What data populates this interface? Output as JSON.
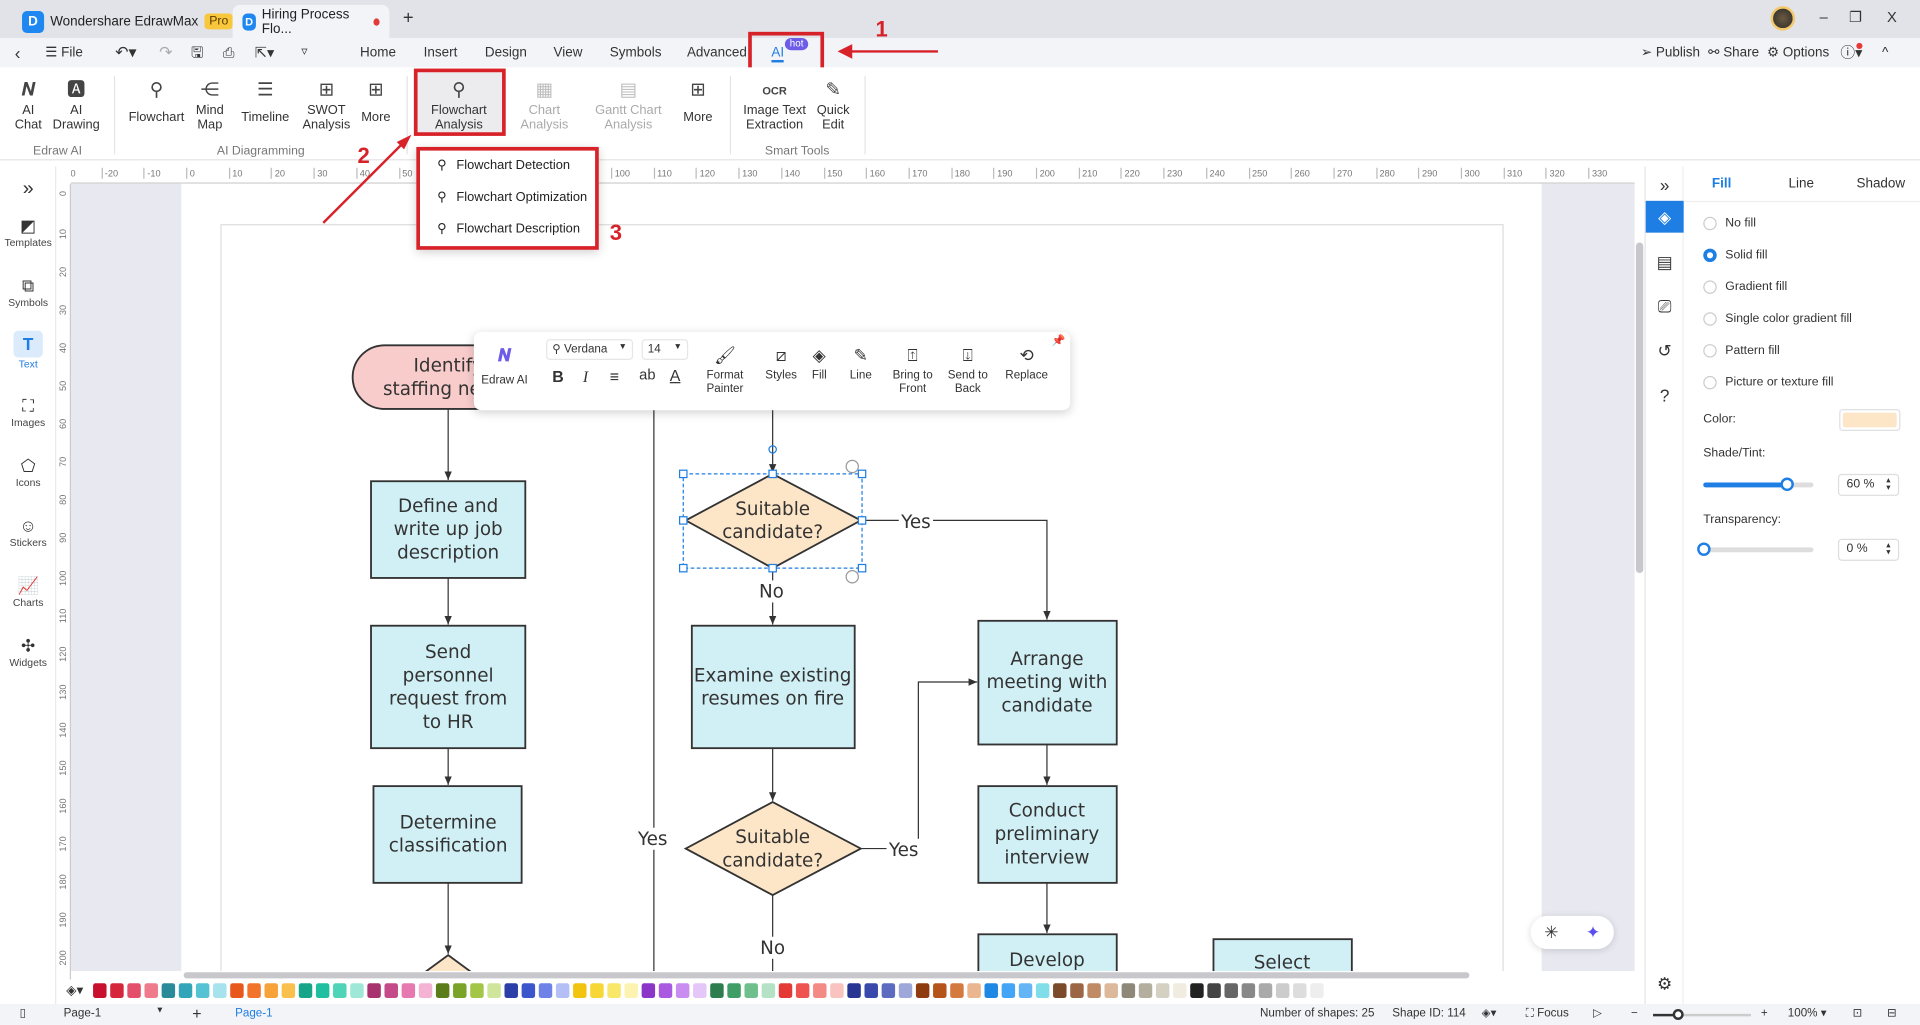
{
  "titlebar": {
    "app_name": "Wondershare EdrawMax",
    "pro_badge": "Pro",
    "doc_tab": "Hiring Process Flo...",
    "new_tab": "+",
    "minimize": "–",
    "restore": "❐",
    "close": "X"
  },
  "menubar": {
    "file": "File",
    "tabs": [
      "Home",
      "Insert",
      "Design",
      "View",
      "Symbols",
      "Advanced",
      "AI"
    ],
    "hot_badge": "hot",
    "publish": "Publish",
    "share": "Share",
    "options": "Options"
  },
  "ribbon": {
    "edraw_ai": {
      "label": "Edraw AI",
      "items": [
        "AI\nChat",
        "AI\nDrawing"
      ]
    },
    "ai_diagramming": {
      "label": "AI Diagramming",
      "items": [
        "Flowchart",
        "Mind\nMap",
        "Timeline",
        "SWOT\nAnalysis",
        "More"
      ]
    },
    "analysis": {
      "items": [
        "Flowchart\nAnalysis",
        "Chart\nAnalysis",
        "Gantt Chart\nAnalysis",
        "More"
      ]
    },
    "smart_tools": {
      "label": "Smart Tools",
      "items": [
        "Image Text\nExtraction",
        "Quick\nEdit"
      ]
    }
  },
  "dropdown": {
    "items": [
      "Flowchart Detection",
      "Flowchart Optimization",
      "Flowchart Description"
    ]
  },
  "annotations": {
    "step1": "1",
    "step2": "2",
    "step3": "3",
    "color": "#d8222a"
  },
  "sidebar": {
    "items": [
      "Templates",
      "Symbols",
      "Text",
      "Images",
      "Icons",
      "Stickers",
      "Charts",
      "Widgets"
    ],
    "active": "Text"
  },
  "rulers": {
    "top": {
      "start": -30,
      "end": 330,
      "step": 10
    },
    "left": {
      "start": 0,
      "end": 200,
      "step": 10
    }
  },
  "float_toolbar": {
    "edraw_ai": "Edraw AI",
    "font": "Verdana",
    "size": "14",
    "format_painter": "Format\nPainter",
    "styles": "Styles",
    "fill": "Fill",
    "line": "Line",
    "bring_front": "Bring to\nFront",
    "send_back": "Send to\nBack",
    "replace": "Replace"
  },
  "flowchart": {
    "terminator": "Identify staffing needs",
    "define": "Define and write up job description",
    "send": "Send personnel request from to HR",
    "determine": "Determine classification",
    "decision1": "Suitable candidate?",
    "examine": "Examine existing resumes on fire",
    "decision2": "Suitable candidate?",
    "arrange": "Arrange meeting with candidate",
    "conduct": "Conduct preliminary interview",
    "develop": "Develop",
    "select": "Select",
    "yes": "Yes",
    "no": "No",
    "box_fill": "#d1f0f5",
    "decision_fill": "#fde6c8",
    "terminator_fill": "#f9cccc"
  },
  "right_panel": {
    "tabs": [
      "Fill",
      "Line",
      "Shadow"
    ],
    "active_tab": "Fill",
    "fill_options": [
      "No fill",
      "Solid fill",
      "Gradient fill",
      "Single color gradient fill",
      "Pattern fill",
      "Picture or texture fill"
    ],
    "selected_option": "Solid fill",
    "color_label": "Color:",
    "color_value": "#fde6c8",
    "shade_label": "Shade/Tint:",
    "shade_value": "60 %",
    "shade_fraction": 0.75,
    "transparency_label": "Transparency:",
    "transparency_value": "0 %",
    "transparency_fraction": 0
  },
  "palette": [
    "#c8102e",
    "#d6263b",
    "#e4506a",
    "#ee7a8c",
    "#2a8a9a",
    "#33a5b8",
    "#55c3d3",
    "#a7e3ec",
    "#e8571b",
    "#f2742c",
    "#f7a33a",
    "#f9c04e",
    "#17a589",
    "#1fbfa0",
    "#4ed4b8",
    "#9fe7d6",
    "#a8326e",
    "#c44a8a",
    "#e67ab0",
    "#f4b3d3",
    "#5a7d1a",
    "#79a428",
    "#a3c646",
    "#cfe59a",
    "#2c3fa8",
    "#3b55cc",
    "#6f82e8",
    "#b4bff5",
    "#f2c40f",
    "#f6d735",
    "#f9e76a",
    "#fcf3b0",
    "#8a35c8",
    "#a95ae0",
    "#c98cf0",
    "#e4c6f9",
    "#2e7d4f",
    "#3f9e66",
    "#6fbf8c",
    "#b5e2c5",
    "#e53935",
    "#ef5350",
    "#f48a85",
    "#f9c3c0",
    "#283593",
    "#3949ab",
    "#5c6bc0",
    "#9fa8da",
    "#8d3b0f",
    "#b45418",
    "#d47a3e",
    "#eab58f",
    "#1e88e5",
    "#42a5f5",
    "#64b5f6",
    "#80deea",
    "#7b4a2a",
    "#9c6644",
    "#c08a65",
    "#ddb99b",
    "#8d8877",
    "#b3ae9d",
    "#d4d0c2",
    "#f0ece0",
    "#222222",
    "#444444",
    "#666666",
    "#888888",
    "#aaaaaa",
    "#cccccc",
    "#dddddd",
    "#eeeeee"
  ],
  "statusbar": {
    "page_selector": "Page-1",
    "add_page": "+",
    "page_tab": "Page-1",
    "shape_count": "Number of shapes: 25",
    "shape_id": "Shape ID: 114",
    "focus": "Focus",
    "zoom": "100%",
    "zoom_fraction": 0.25
  }
}
